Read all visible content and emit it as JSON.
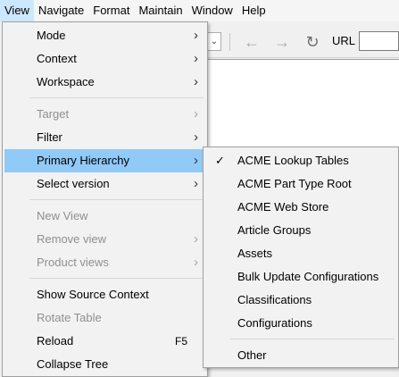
{
  "menubar": {
    "items": [
      {
        "label": "View",
        "active": true
      },
      {
        "label": "Navigate"
      },
      {
        "label": "Format"
      },
      {
        "label": "Maintain"
      },
      {
        "label": "Window"
      },
      {
        "label": "Help"
      }
    ]
  },
  "toolbar": {
    "dropdown_icon": "chevron-down-icon",
    "back_icon": "arrow-left-icon",
    "forward_icon": "arrow-right-icon",
    "reload_icon": "refresh-icon",
    "url_label": "URL",
    "url_value": ""
  },
  "view_menu": {
    "items": [
      {
        "label": "Mode",
        "submenu": true
      },
      {
        "label": "Context",
        "submenu": true
      },
      {
        "label": "Workspace",
        "submenu": true
      },
      {
        "label": "Target",
        "submenu": true,
        "disabled": true
      },
      {
        "label": "Filter",
        "submenu": true
      },
      {
        "label": "Primary Hierarchy",
        "submenu": true,
        "highlighted": true
      },
      {
        "label": "Select version",
        "submenu": true
      },
      {
        "label": "New View",
        "disabled": true
      },
      {
        "label": "Remove view",
        "submenu": true,
        "disabled": true
      },
      {
        "label": "Product views",
        "submenu": true,
        "disabled": true
      },
      {
        "label": "Show Source Context"
      },
      {
        "label": "Rotate Table",
        "disabled": true
      },
      {
        "label": "Reload",
        "shortcut": "F5"
      },
      {
        "label": "Collapse Tree"
      }
    ],
    "arrow_glyph": "›"
  },
  "primary_hierarchy_menu": {
    "check_glyph": "✓",
    "items": [
      {
        "label": "ACME Lookup Tables",
        "checked": true
      },
      {
        "label": "ACME Part Type Root"
      },
      {
        "label": "ACME Web Store"
      },
      {
        "label": "Article Groups"
      },
      {
        "label": "Assets"
      },
      {
        "label": "Bulk Update Configurations"
      },
      {
        "label": "Classifications"
      },
      {
        "label": "Configurations"
      },
      {
        "label": "Other"
      }
    ]
  },
  "colors": {
    "menu_highlight": "#91c9f7",
    "menubar_active": "#cce8ff",
    "disabled_text": "#8f8f8f"
  }
}
